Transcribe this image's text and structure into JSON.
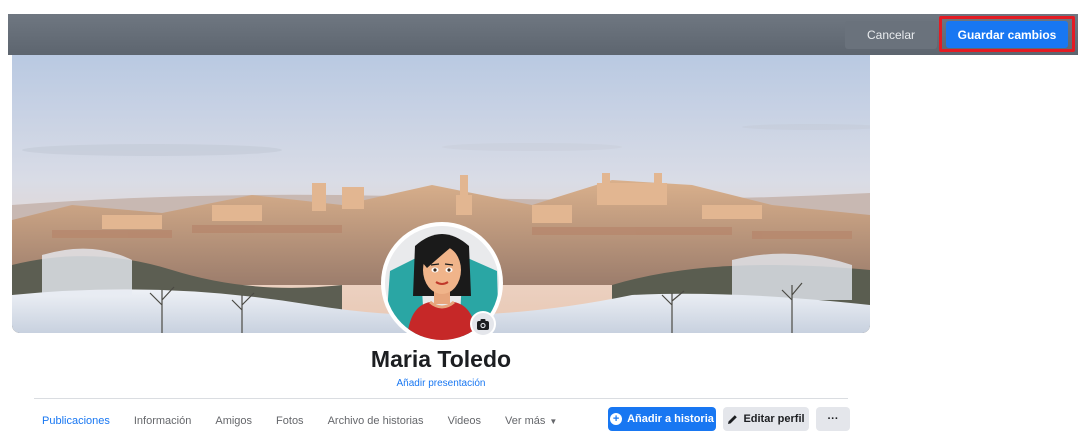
{
  "topbar": {
    "cancel_label": "Cancelar",
    "save_label": "Guardar cambios"
  },
  "profile": {
    "name": "Maria Toledo",
    "add_bio_label": "Añadir presentación"
  },
  "tabs": [
    {
      "label": "Publicaciones",
      "active": true
    },
    {
      "label": "Información"
    },
    {
      "label": "Amigos"
    },
    {
      "label": "Fotos"
    },
    {
      "label": "Archivo de historias"
    },
    {
      "label": "Videos"
    },
    {
      "label": "Ver más"
    }
  ],
  "actions": {
    "add_story_label": "Añadir a historia",
    "edit_profile_label": "Editar perfil",
    "more_label": "···"
  },
  "colors": {
    "accent": "#1877f2",
    "highlight": "#e31b23"
  },
  "icons": {
    "camera": "camera-icon",
    "plus": "plus-circle-icon",
    "pencil": "pencil-icon",
    "caret": "caret-down-icon"
  }
}
